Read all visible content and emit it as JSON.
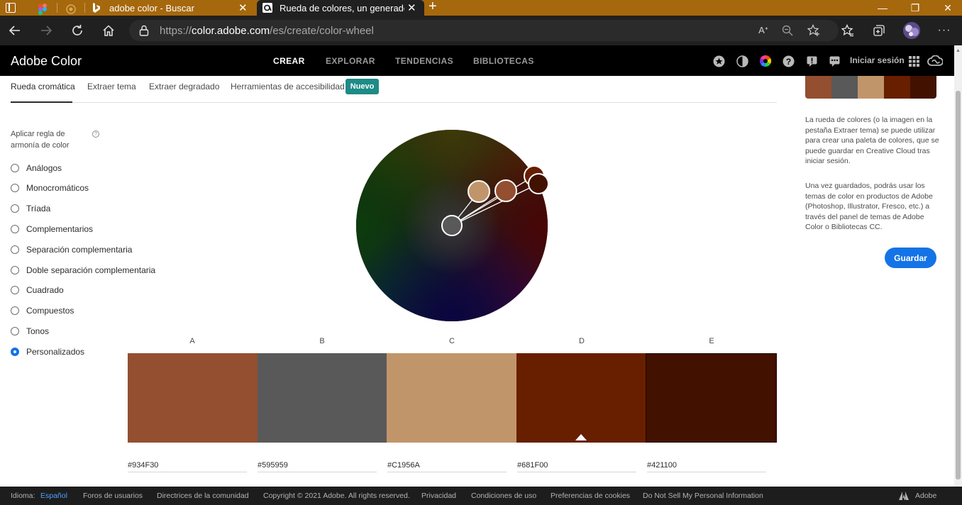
{
  "browser": {
    "tabs": [
      {
        "title": "adobe color - Buscar"
      },
      {
        "title": "Rueda de colores, un generador"
      }
    ],
    "url_host": "color.adobe.com",
    "url_prefix": "https://",
    "url_path": "/es/create/color-wheel"
  },
  "header": {
    "brand": "Adobe Color",
    "nav": [
      "CREAR",
      "EXPLORAR",
      "TENDENCIAS",
      "BIBLIOTECAS"
    ],
    "signin": "Iniciar sesión"
  },
  "subtabs": [
    "Rueda cromática",
    "Extraer tema",
    "Extraer degradado",
    "Herramientas de accesibilidad"
  ],
  "badge_new": "Nuevo",
  "harmony": {
    "title": "Aplicar regla de armonía de color",
    "help": "?",
    "rules": [
      "Análogos",
      "Monocromáticos",
      "Tríada",
      "Complementarios",
      "Separación complementaria",
      "Doble separación complementaria",
      "Cuadrado",
      "Compuestos",
      "Tonos",
      "Personalizados"
    ],
    "selected": "Personalizados"
  },
  "swatches": [
    {
      "letter": "A",
      "hex": "#934F30"
    },
    {
      "letter": "B",
      "hex": "#595959"
    },
    {
      "letter": "C",
      "hex": "#C1956A"
    },
    {
      "letter": "D",
      "hex": "#681F00"
    },
    {
      "letter": "E",
      "hex": "#421100"
    }
  ],
  "right_panel": {
    "info1": "La rueda de colores (o la imagen en la pestaña Extraer tema) se puede utilizar para crear una paleta de colores, que se puede guardar en Creative Cloud tras iniciar sesión.",
    "info2": "Una vez guardados, podrás usar los temas de color en productos de Adobe (Photoshop, Illustrator, Fresco, etc.) a través del panel de temas de Adobe Color o Bibliotecas CC.",
    "save_label": "Guardar"
  },
  "footer": {
    "language_label": "Idioma:",
    "language_value": "Español",
    "links": [
      "Foros de usuarios",
      "Directrices de la comunidad",
      "Copyright © 2021 Adobe. All rights reserved.",
      "Privacidad",
      "Condiciones de uso",
      "Preferencias de cookies",
      "Do Not Sell My Personal Information"
    ],
    "adobe": "Adobe"
  },
  "colors": {
    "accent": "#1473e6",
    "badge": "#1e8b86",
    "tabbar": "#a6680c"
  }
}
